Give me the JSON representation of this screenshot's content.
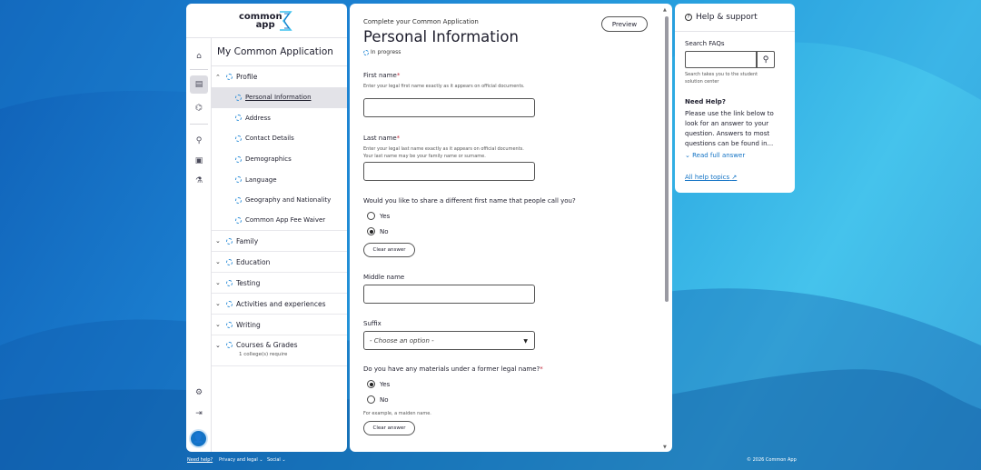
{
  "logo": {
    "line1": "common",
    "line2": "app"
  },
  "nav": {
    "title": "My Common Application",
    "sections": [
      {
        "label": "Profile",
        "expanded": true
      },
      {
        "label": "Family"
      },
      {
        "label": "Education"
      },
      {
        "label": "Testing"
      },
      {
        "label": "Activities and experiences"
      },
      {
        "label": "Writing"
      },
      {
        "label": "Courses & Grades",
        "note": "1 college(s) require"
      }
    ],
    "profile_items": [
      "Personal Information",
      "Address",
      "Contact Details",
      "Demographics",
      "Language",
      "Geography and Nationality",
      "Common App Fee Waiver"
    ]
  },
  "main": {
    "eyebrow": "Complete your Common Application",
    "title": "Personal Information",
    "status": "In progress",
    "preview": "Preview",
    "first_name": {
      "label": "First name",
      "req": "*",
      "help": "Enter your legal first name exactly as it appears on official documents."
    },
    "last_name": {
      "label": "Last name",
      "req": "*",
      "help": "Enter your legal last name exactly as it appears on official documents. Your last name may be your family name or surname."
    },
    "preferred_q": "Would you like to share a different first name that people call you?",
    "yes": "Yes",
    "no": "No",
    "clear": "Clear answer",
    "middle_name": "Middle name",
    "suffix": {
      "label": "Suffix",
      "value": "- Choose an option -"
    },
    "former_q": "Do you have any materials under a former legal name?",
    "former_req": "*",
    "former_help": "For example, a maiden name."
  },
  "help": {
    "title": "Help & support",
    "search_label": "Search FAQs",
    "search_note": "Search takes you to the student solution center",
    "need_help": "Need Help?",
    "body": "Please use the link below to look for an answer to your question. Answers to most questions can be found in...",
    "read_full": "Read full answer",
    "all_topics": "All help topics"
  },
  "footer": {
    "need_help": "Need help?",
    "privacy": "Privacy and legal",
    "social": "Social",
    "copyright": "© 2026 Common App"
  },
  "colors": {
    "accent": "#1373c5",
    "status_dot": "#2f8fd8",
    "required": "#c0283b"
  }
}
